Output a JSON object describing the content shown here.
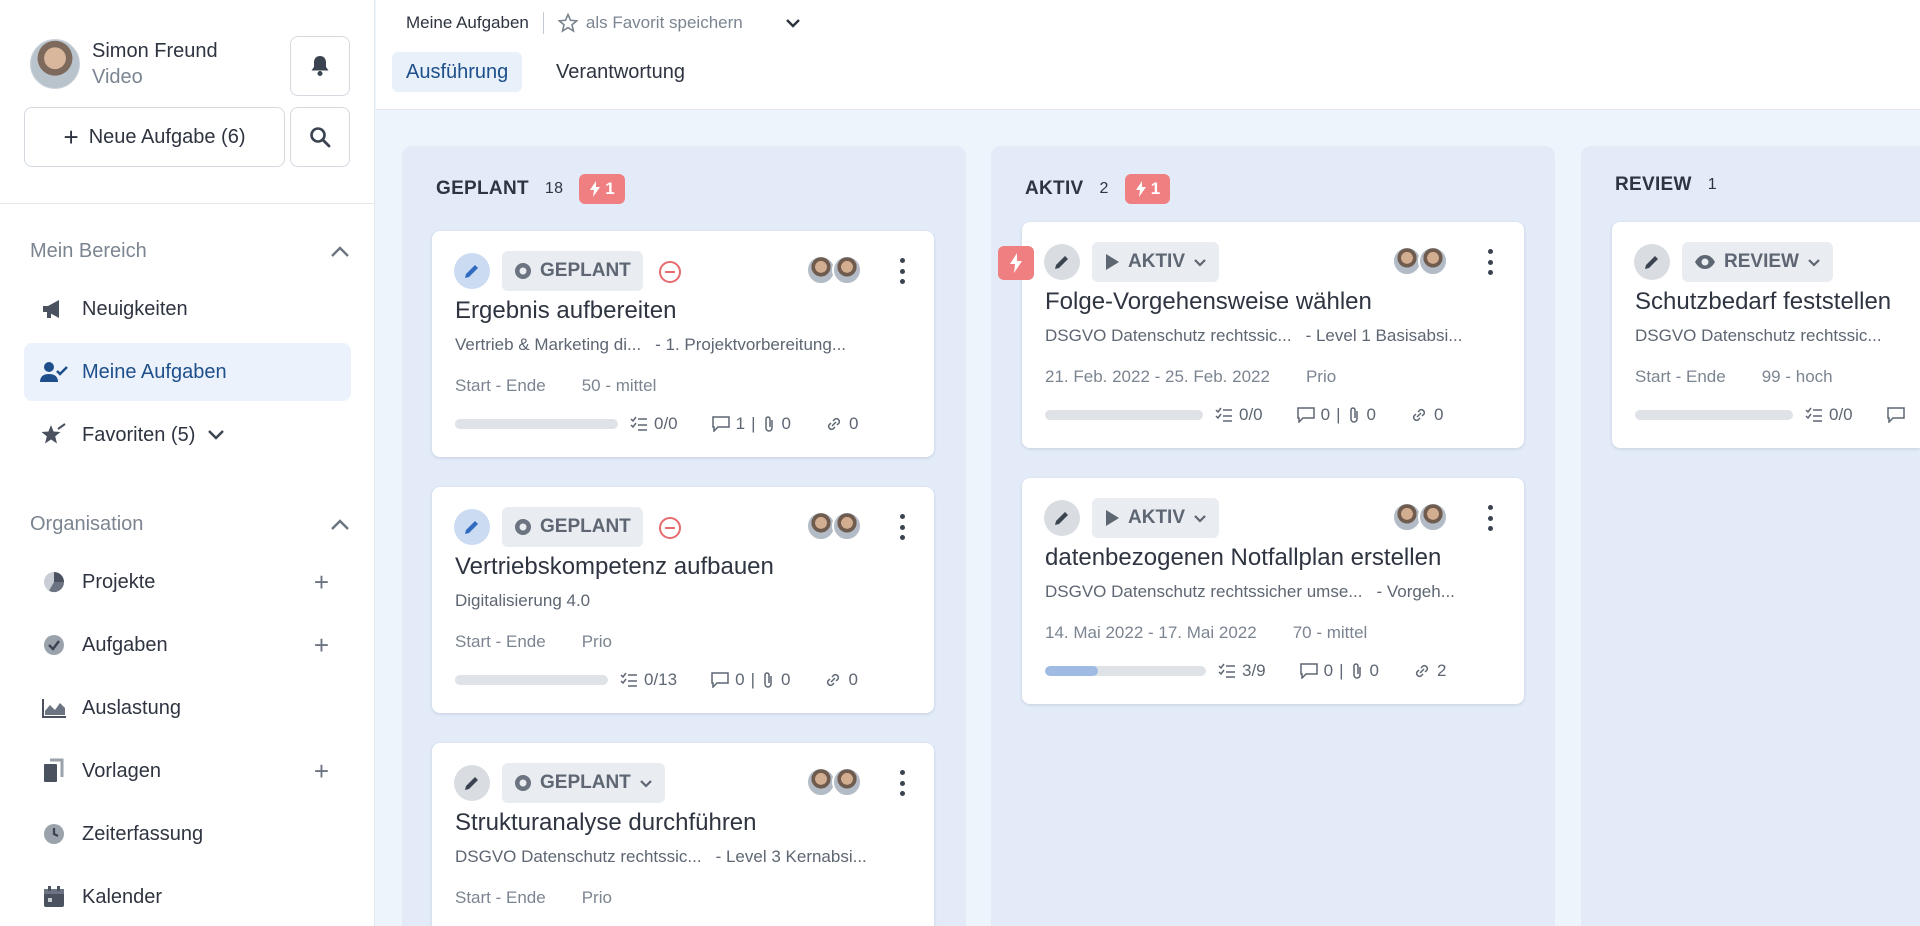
{
  "user": {
    "name": "Simon Freund",
    "role": "Video"
  },
  "sidebar": {
    "new_task_label": "Neue Aufgabe (6)",
    "section_my_area": "Mein Bereich",
    "items_my_area": [
      {
        "label": "Neuigkeiten",
        "icon": "megaphone-icon"
      },
      {
        "label": "Meine Aufgaben",
        "icon": "user-check-icon"
      },
      {
        "label": "Favoriten (5)",
        "icon": "star-icon"
      }
    ],
    "section_org": "Organisation",
    "items_org": [
      {
        "label": "Projekte",
        "icon": "pie-chart-icon"
      },
      {
        "label": "Aufgaben",
        "icon": "check-circle-icon"
      },
      {
        "label": "Auslastung",
        "icon": "area-chart-icon"
      },
      {
        "label": "Vorlagen",
        "icon": "copy-icon"
      },
      {
        "label": "Zeiterfassung",
        "icon": "clock-icon"
      },
      {
        "label": "Kalender",
        "icon": "calendar-icon"
      }
    ]
  },
  "header": {
    "breadcrumb": "Meine Aufgaben",
    "favorite_label": "als Favorit speichern",
    "tabs": [
      {
        "label": "Ausführung"
      },
      {
        "label": "Verantwortung"
      }
    ]
  },
  "columns": [
    {
      "title": "GEPLANT",
      "count": "18",
      "flag": "1",
      "cards": [
        {
          "status": "GEPLANT",
          "title": "Ergebnis aufbereiten",
          "project": "Vertrieb & Marketing di...",
          "phase": "- 1. Projektvorbereitung...",
          "dates": "Start - Ende",
          "prio": "50 - mittel",
          "progress": 0,
          "checklist": "0/0",
          "comments": "1",
          "attachments": "0",
          "links": "0"
        },
        {
          "status": "GEPLANT",
          "title": "Vertriebskompetenz aufbauen",
          "project": "Digitalisierung 4.0",
          "phase": "",
          "dates": "Start - Ende",
          "prio": "Prio",
          "progress": 0,
          "checklist": "0/13",
          "comments": "0",
          "attachments": "0",
          "links": "0"
        },
        {
          "status": "GEPLANT",
          "title": "Strukturanalyse durchführen",
          "project": "DSGVO Datenschutz rechtssic...",
          "phase": "- Level 3 Kernabsi...",
          "dates": "Start - Ende",
          "prio": "Prio"
        }
      ]
    },
    {
      "title": "AKTIV",
      "count": "2",
      "flag": "1",
      "cards": [
        {
          "status": "AKTIV",
          "title": "Folge-Vorgehensweise wählen",
          "project": "DSGVO Datenschutz rechtssic...",
          "phase": "- Level 1 Basisabsi...",
          "dates": "21. Feb. 2022 - 25. Feb. 2022",
          "prio": "Prio",
          "progress": 0,
          "checklist": "0/0",
          "comments": "0",
          "attachments": "0",
          "links": "0"
        },
        {
          "status": "AKTIV",
          "title": "datenbezogenen Notfallplan erstellen",
          "project": "DSGVO Datenschutz rechtssicher umse...",
          "phase": "- Vorgeh...",
          "dates": "14. Mai 2022 - 17. Mai 2022",
          "prio": "70 - mittel",
          "progress": 0.33,
          "checklist": "3/9",
          "comments": "0",
          "attachments": "0",
          "links": "2"
        }
      ]
    },
    {
      "title": "REVIEW",
      "count": "1",
      "cards": [
        {
          "status": "REVIEW",
          "title": "Schutzbedarf feststellen",
          "project": "DSGVO Datenschutz rechtssic...",
          "dates": "Start - Ende",
          "prio": "99 - hoch",
          "progress": 0,
          "checklist": "0/0"
        }
      ]
    }
  ]
}
